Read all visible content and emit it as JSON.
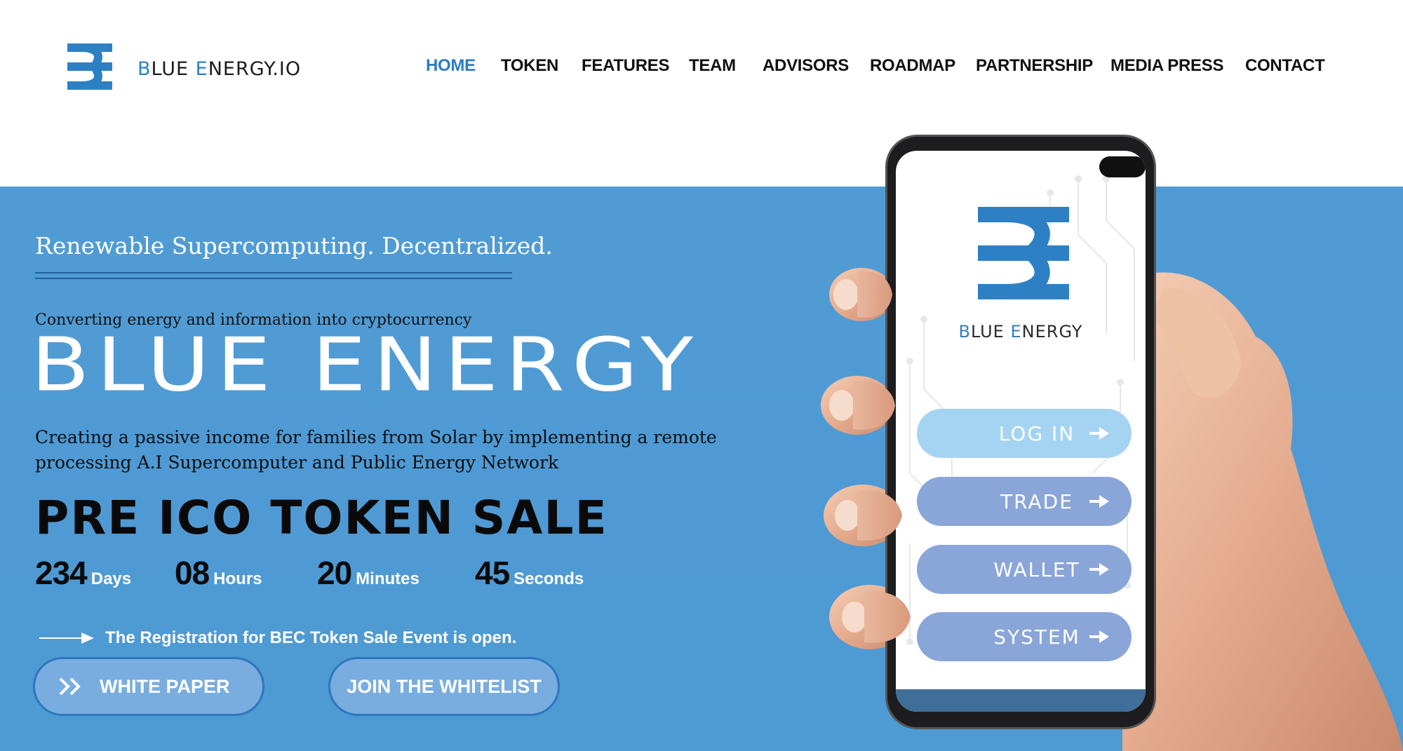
{
  "brand": {
    "first_letter": "B",
    "rest_first": "LUE ",
    "second_letter": "E",
    "rest_second": "NERGY.IO"
  },
  "nav": {
    "items": [
      {
        "label": "HOME",
        "active": true
      },
      {
        "label": "TOKEN"
      },
      {
        "label": "FEATURES"
      },
      {
        "label": "TEAM"
      },
      {
        "label": "ADVISORS"
      },
      {
        "label": "ROADMAP"
      },
      {
        "label": "PARTNERSHIP"
      },
      {
        "label": "MEDIA PRESS"
      },
      {
        "label": "CONTACT"
      }
    ]
  },
  "hero": {
    "tagline": "Renewable Supercomputing. Decentralized.",
    "subtitle": "Converting energy and information into cryptocurrency",
    "title": "BLUE ENERGY",
    "description": "Creating a passive income for families from Solar by implementing a remote processing A.I Supercomputer and Public Energy Network",
    "presale_heading": "PRE ICO TOKEN SALE",
    "registration_text": "The Registration for BEC Token Sale Event is open."
  },
  "countdown": {
    "days": "234",
    "days_label": "Days",
    "hours": "08",
    "hours_label": "Hours",
    "minutes": "20",
    "minutes_label": "Minutes",
    "seconds": "45",
    "seconds_label": "Seconds"
  },
  "buttons": {
    "white_paper": "WHITE PAPER",
    "whitelist": "JOIN THE WHITELIST"
  },
  "phone": {
    "brand_first": "B",
    "brand_rest1": "LUE ",
    "brand_second": "E",
    "brand_rest2": "NERGY",
    "login": "LOG IN",
    "trade": "TRADE",
    "wallet": "WALLET",
    "system": "SYSTEM"
  },
  "colors": {
    "accent": "#2d7cc1",
    "hero_bg": "#509bd4",
    "logo_blue": "#2e80c4"
  }
}
